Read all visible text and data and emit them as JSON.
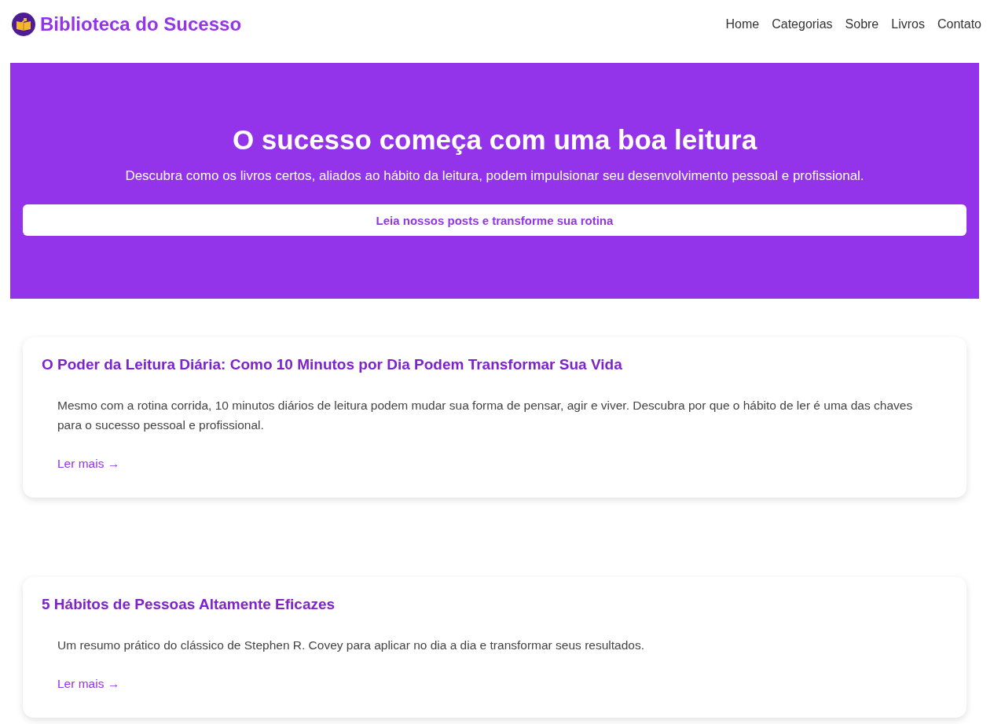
{
  "header": {
    "brand": "Biblioteca do Sucesso",
    "nav": [
      "Home",
      "Categorias",
      "Sobre",
      "Livros",
      "Contato"
    ]
  },
  "hero": {
    "title": "O sucesso começa com uma boa leitura",
    "subtitle": "Descubra como os livros certos, aliados ao hábito da leitura, podem impulsionar seu desenvolvimento pessoal e profissional.",
    "button": "Leia nossos posts e transforme sua rotina"
  },
  "posts": [
    {
      "title": "O Poder da Leitura Diária: Como 10 Minutos por Dia Podem Transformar Sua Vida",
      "excerpt": "Mesmo com a rotina corrida, 10 minutos diários de leitura podem mudar sua forma de pensar, agir e viver. Descubra por que o hábito de ler é uma das chaves para o sucesso pessoal e profissional.",
      "link": "Ler mais →"
    },
    {
      "title": "5 Hábitos de Pessoas Altamente Eficazes",
      "excerpt": "Um resumo prático do clássico de Stephen R. Covey para aplicar no dia a dia e transformar seus resultados.",
      "link": "Ler mais →"
    }
  ]
}
